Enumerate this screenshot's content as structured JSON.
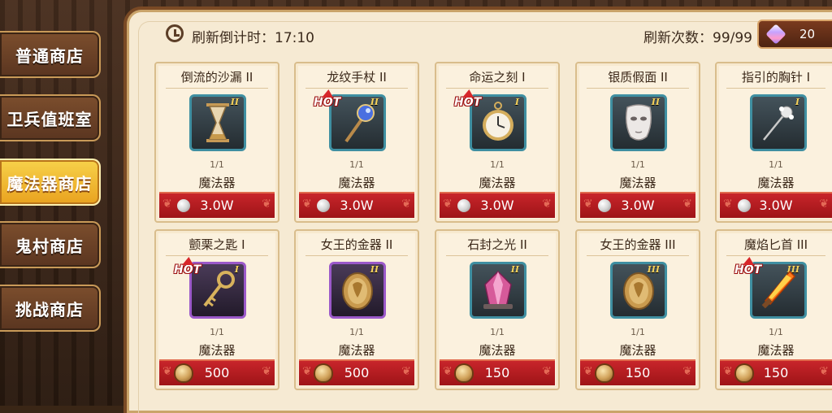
{
  "nav": {
    "items": [
      {
        "label": "普通商店"
      },
      {
        "label": "卫兵值班室"
      },
      {
        "label": "魔法器商店",
        "active": true
      },
      {
        "label": "鬼村商店"
      },
      {
        "label": "挑战商店"
      }
    ]
  },
  "header": {
    "countdown_label": "刷新倒计时：17:10",
    "refresh_label": "刷新次数：99/99",
    "gem_count": "20"
  },
  "items": [
    {
      "name": "倒流的沙漏 II",
      "tier": "II",
      "hot": false,
      "stock": "1/1",
      "type": "魔法器",
      "currency": "silver-coin",
      "price": "3.0W"
    },
    {
      "name": "龙纹手杖 II",
      "tier": "II",
      "hot": true,
      "stock": "1/1",
      "type": "魔法器",
      "currency": "silver-coin",
      "price": "3.0W"
    },
    {
      "name": "命运之刻 I",
      "tier": "I",
      "hot": true,
      "stock": "1/1",
      "type": "魔法器",
      "currency": "silver-coin",
      "price": "3.0W"
    },
    {
      "name": "银质假面 II",
      "tier": "II",
      "hot": false,
      "stock": "1/1",
      "type": "魔法器",
      "currency": "silver-coin",
      "price": "3.0W"
    },
    {
      "name": "指引的胸针 I",
      "tier": "I",
      "hot": false,
      "stock": "1/1",
      "type": "魔法器",
      "currency": "silver-coin",
      "price": "3.0W"
    },
    {
      "name": "颤栗之匙 I",
      "tier": "I",
      "hot": true,
      "stock": "1/1",
      "type": "魔法器",
      "currency": "honor-badge",
      "price": "500"
    },
    {
      "name": "女王的金器 II",
      "tier": "II",
      "hot": false,
      "stock": "1/1",
      "type": "魔法器",
      "currency": "honor-badge",
      "price": "500"
    },
    {
      "name": "石封之光 II",
      "tier": "II",
      "hot": false,
      "stock": "1/1",
      "type": "魔法器",
      "currency": "honor-badge",
      "price": "150"
    },
    {
      "name": "女王的金器 III",
      "tier": "III",
      "hot": false,
      "stock": "1/1",
      "type": "魔法器",
      "currency": "honor-badge",
      "price": "150"
    },
    {
      "name": "魔焰匕首 III",
      "tier": "III",
      "hot": true,
      "stock": "1/1",
      "type": "魔法器",
      "currency": "honor-badge",
      "price": "150"
    }
  ],
  "hot_label": "HOT"
}
